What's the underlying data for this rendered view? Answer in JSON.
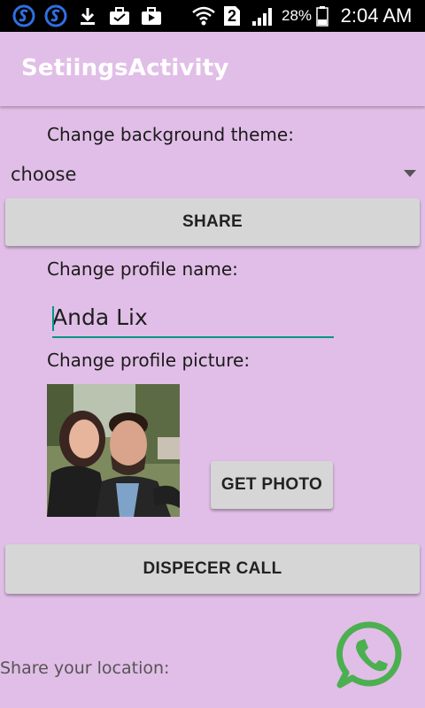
{
  "status_bar": {
    "battery_percent": "28%",
    "time": "2:04 AM",
    "sim_slot": "2",
    "icons": [
      "s-app-icon",
      "s-app-icon",
      "download-icon",
      "briefcase-icon",
      "briefcase-icon",
      "wifi-icon",
      "sim-2-icon",
      "signal-icon",
      "battery-icon"
    ]
  },
  "action_bar": {
    "title": "SetiingsActivity"
  },
  "theme": {
    "label": "Change background theme:",
    "selected": "choose"
  },
  "share_button": "SHARE",
  "profile_name": {
    "label": "Change profile name:",
    "value": "Anda Lix"
  },
  "profile_picture": {
    "label": "Change profile picture:",
    "get_photo_button": "GET PHOTO"
  },
  "dispecer_button": "DISPECER CALL",
  "location": {
    "label": "Share your location:"
  },
  "colors": {
    "background": "#E1BEE7",
    "accent": "#009688",
    "whatsapp": "#4CAF50"
  }
}
